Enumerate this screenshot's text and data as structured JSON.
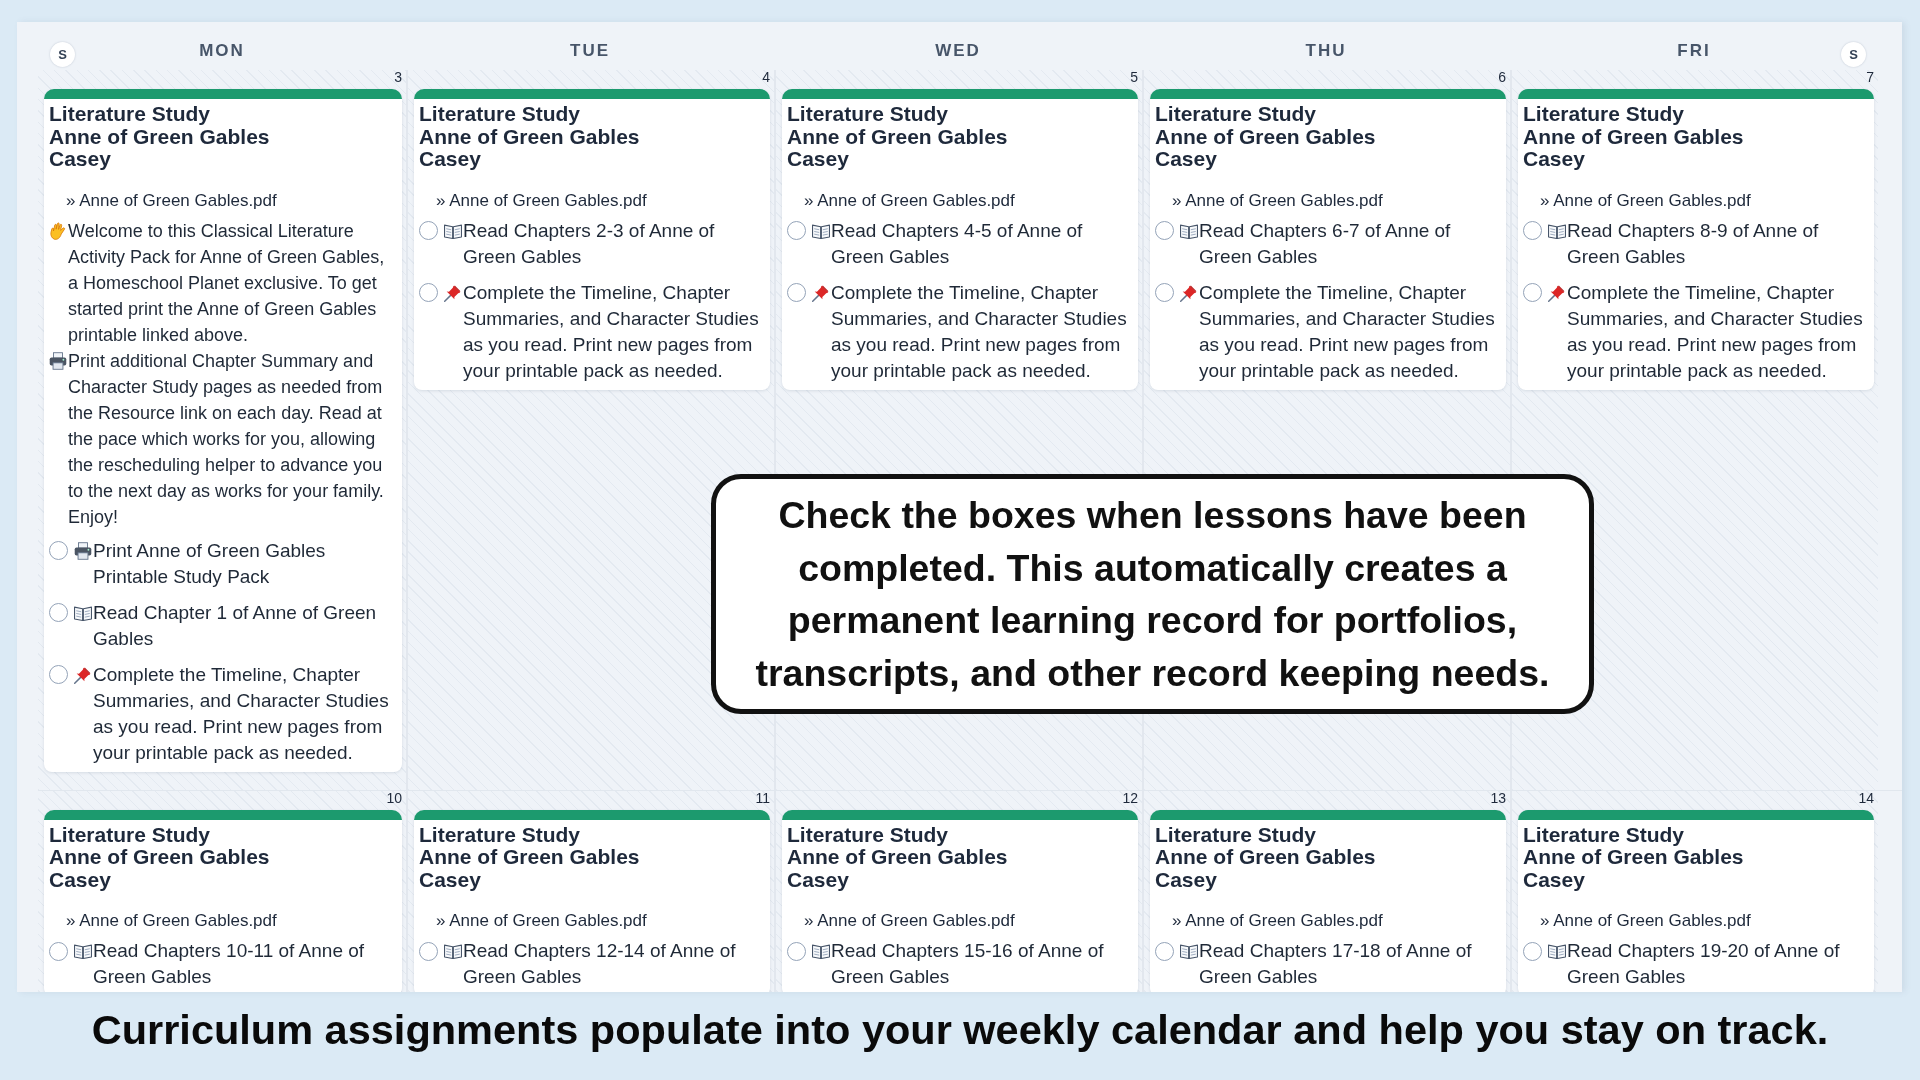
{
  "header": {
    "weekend_toggles": [
      "S",
      "S"
    ],
    "days": [
      "MON",
      "TUE",
      "WED",
      "THU",
      "FRI"
    ]
  },
  "weeks": [
    {
      "days": [
        {
          "date": "3",
          "card": {
            "title": "Literature Study",
            "course": "Anne of Green Gables",
            "student": "Casey",
            "resource": "» Anne of Green Gables.pdf",
            "notes": [
              {
                "kind": "wave",
                "text": "Welcome to this Classical Literature Activity Pack for Anne of Green Gables, a Homeschool Planet exclusive. To get started print the Anne of Green Gables printable linked above."
              },
              {
                "kind": "print",
                "text": "Print additional Chapter Summary and Character Study pages as needed from the Resource link on each day. Read at the pace which works for you, allowing the rescheduling helper to advance you to the next day as works for your family. Enjoy!"
              }
            ],
            "tasks": [
              {
                "kind": "print",
                "text": "Print Anne of Green Gables Printable Study Pack",
                "checked": false
              },
              {
                "kind": "read",
                "text": "Read Chapter 1 of Anne of Green Gables",
                "checked": false
              },
              {
                "kind": "pin",
                "text": "Complete the Timeline, Chapter Summaries, and Character Studies as you read. Print new pages from your printable pack as needed.",
                "checked": false
              }
            ]
          }
        },
        {
          "date": "4",
          "card": {
            "title": "Literature Study",
            "course": "Anne of Green Gables",
            "student": "Casey",
            "resource": "» Anne of Green Gables.pdf",
            "tasks": [
              {
                "kind": "read",
                "text": "Read Chapters 2-3 of Anne of Green Gables",
                "checked": false
              },
              {
                "kind": "pin",
                "text": "Complete the Timeline, Chapter Summaries, and Character Studies as you read. Print new pages from your printable pack as needed.",
                "checked": false
              }
            ]
          }
        },
        {
          "date": "5",
          "card": {
            "title": "Literature Study",
            "course": "Anne of Green Gables",
            "student": "Casey",
            "resource": "» Anne of Green Gables.pdf",
            "tasks": [
              {
                "kind": "read",
                "text": "Read Chapters 4-5 of Anne of Green Gables",
                "checked": false
              },
              {
                "kind": "pin",
                "text": "Complete the Timeline, Chapter Summaries, and Character Studies as you read. Print new pages from your printable pack as needed.",
                "checked": false
              }
            ]
          }
        },
        {
          "date": "6",
          "card": {
            "title": "Literature Study",
            "course": "Anne of Green Gables",
            "student": "Casey",
            "resource": "» Anne of Green Gables.pdf",
            "tasks": [
              {
                "kind": "read",
                "text": "Read Chapters 6-7 of Anne of Green Gables",
                "checked": false
              },
              {
                "kind": "pin",
                "text": "Complete the Timeline, Chapter Summaries, and Character Studies as you read. Print new pages from your printable pack as needed.",
                "checked": false
              }
            ]
          }
        },
        {
          "date": "7",
          "card": {
            "title": "Literature Study",
            "course": "Anne of Green Gables",
            "student": "Casey",
            "resource": "» Anne of Green Gables.pdf",
            "tasks": [
              {
                "kind": "read",
                "text": "Read Chapters 8-9 of Anne of Green Gables",
                "checked": false
              },
              {
                "kind": "pin",
                "text": "Complete the Timeline, Chapter Summaries, and Character Studies as you read. Print new pages from your printable pack as needed.",
                "checked": false
              }
            ]
          }
        }
      ]
    },
    {
      "days": [
        {
          "date": "10",
          "card": {
            "title": "Literature Study",
            "course": "Anne of Green Gables",
            "student": "Casey",
            "resource": "» Anne of Green Gables.pdf",
            "tasks": [
              {
                "kind": "read",
                "text": "Read Chapters 10-11 of Anne of Green Gables",
                "checked": false
              }
            ]
          }
        },
        {
          "date": "11",
          "card": {
            "title": "Literature Study",
            "course": "Anne of Green Gables",
            "student": "Casey",
            "resource": "» Anne of Green Gables.pdf",
            "tasks": [
              {
                "kind": "read",
                "text": "Read Chapters 12-14 of Anne of Green Gables",
                "checked": false
              }
            ]
          }
        },
        {
          "date": "12",
          "card": {
            "title": "Literature Study",
            "course": "Anne of Green Gables",
            "student": "Casey",
            "resource": "» Anne of Green Gables.pdf",
            "tasks": [
              {
                "kind": "read",
                "text": "Read Chapters 15-16 of Anne of Green Gables",
                "checked": false
              }
            ]
          }
        },
        {
          "date": "13",
          "card": {
            "title": "Literature Study",
            "course": "Anne of Green Gables",
            "student": "Casey",
            "resource": "» Anne of Green Gables.pdf",
            "tasks": [
              {
                "kind": "read",
                "text": "Read Chapters 17-18 of Anne of Green Gables",
                "checked": false
              }
            ]
          }
        },
        {
          "date": "14",
          "card": {
            "title": "Literature Study",
            "course": "Anne of Green Gables",
            "student": "Casey",
            "resource": "» Anne of Green Gables.pdf",
            "tasks": [
              {
                "kind": "read",
                "text": "Read Chapters 19-20 of Anne of Green Gables",
                "checked": false
              }
            ]
          }
        }
      ]
    }
  ],
  "callout": "Check the boxes when lessons have been completed. This automatically creates a permanent learning record for portfolios, transcripts, and other record keeping needs.",
  "caption": "Curriculum assignments populate into your weekly calendar and help you stay on track."
}
